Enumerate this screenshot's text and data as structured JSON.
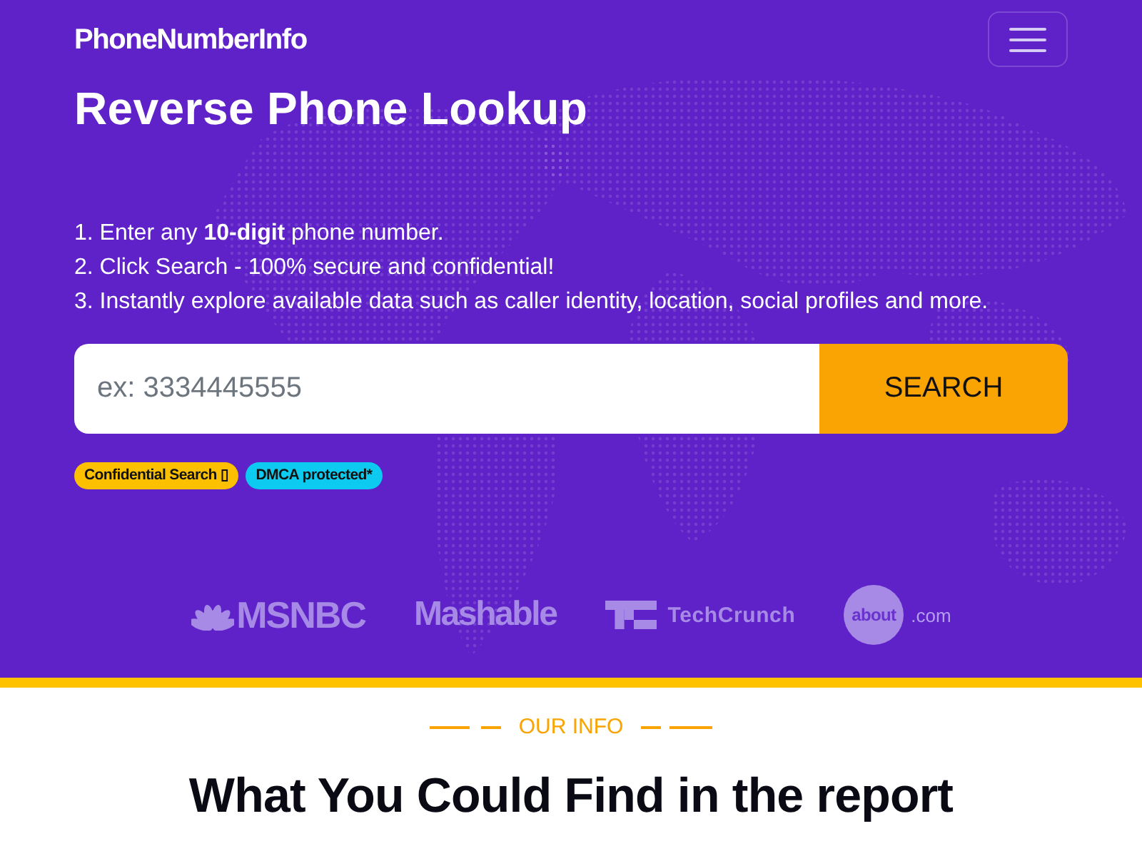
{
  "header": {
    "logo": "PhoneNumberInfo"
  },
  "hero": {
    "title": "Reverse Phone Lookup",
    "steps": [
      "1. Enter any **10-digit** phone number.",
      "2. Click Search - 100% secure and confidential!",
      "3. Instantly explore available data such as caller identity, location, social profiles and more."
    ],
    "search": {
      "placeholder": "ex: 3334445555",
      "button": "SEARCH"
    },
    "badges": [
      {
        "label": "Confidential Search ▯",
        "color": "#fcc000"
      },
      {
        "label": "DMCA protected*",
        "color": "#0dcaf0"
      }
    ],
    "press_logos": [
      {
        "kind": "msnbc",
        "name": "MSNBC"
      },
      {
        "kind": "mashable",
        "name": "Mashable"
      },
      {
        "kind": "techcrunch",
        "name": "TechCrunch"
      },
      {
        "kind": "about",
        "name": "about",
        "suffix": ".com"
      }
    ]
  },
  "info_section": {
    "eyebrow": "OUR INFO",
    "heading": "What You Could Find in the report"
  }
}
